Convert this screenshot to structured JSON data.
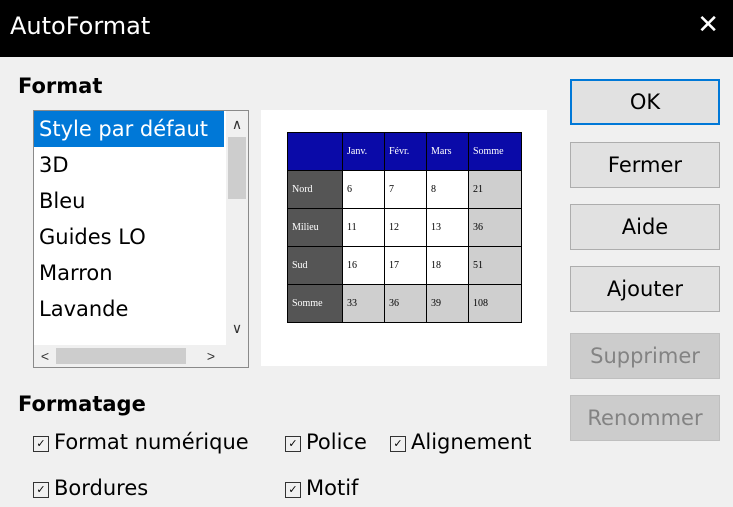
{
  "window": {
    "title": "AutoFormat"
  },
  "format_section": {
    "label": "Format",
    "items": [
      {
        "label": "Style par défaut",
        "selected": true
      },
      {
        "label": "3D"
      },
      {
        "label": "Bleu"
      },
      {
        "label": "Guides LO"
      },
      {
        "label": "Marron"
      },
      {
        "label": "Lavande"
      }
    ]
  },
  "preview": {
    "header": [
      "",
      "Janv.",
      "Févr.",
      "Mars",
      "Somme"
    ],
    "rows": [
      [
        "Nord",
        "6",
        "7",
        "8",
        "21"
      ],
      [
        "Milieu",
        "11",
        "12",
        "13",
        "36"
      ],
      [
        "Sud",
        "16",
        "17",
        "18",
        "51"
      ],
      [
        "Somme",
        "33",
        "36",
        "39",
        "108"
      ]
    ]
  },
  "buttons": {
    "ok": "OK",
    "close": "Fermer",
    "help": "Aide",
    "add": "Ajouter",
    "delete": "Supprimer",
    "rename": "Renommer"
  },
  "formatting_section": {
    "label": "Formatage",
    "options": {
      "number_format": {
        "label": "Format numérique",
        "checked": true
      },
      "font": {
        "label": "Police",
        "checked": true
      },
      "alignment": {
        "label": "Alignement",
        "checked": true
      },
      "borders": {
        "label": "Bordures",
        "checked": true
      },
      "pattern": {
        "label": "Motif",
        "checked": true
      }
    }
  },
  "colors": {
    "selection": "#0078d7",
    "preview_header": "#0a0aa8",
    "preview_row_header": "#555555",
    "preview_sum": "#cfcfcf"
  }
}
